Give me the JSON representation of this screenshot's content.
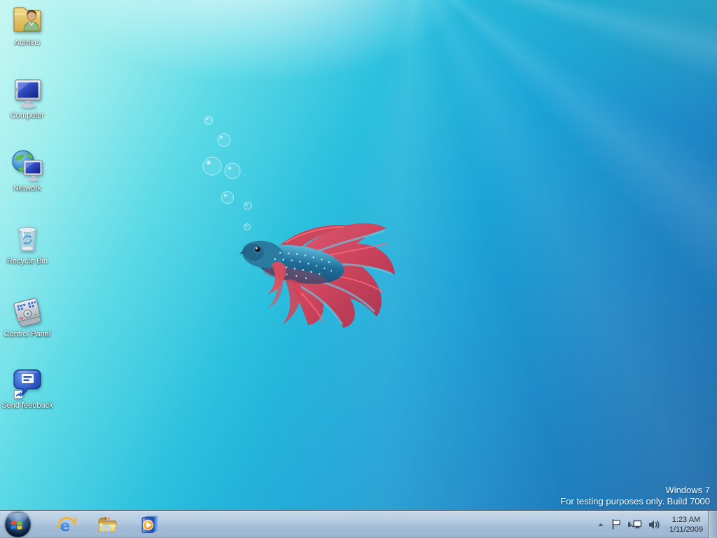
{
  "desktop": {
    "icons": [
      {
        "name": "user-folder-icon",
        "label": "Admins"
      },
      {
        "name": "computer-icon",
        "label": "Computer"
      },
      {
        "name": "network-icon",
        "label": "Network"
      },
      {
        "name": "recycle-bin-icon",
        "label": "Recycle Bin"
      },
      {
        "name": "control-panel-icon",
        "label": "Control Panel"
      },
      {
        "name": "send-feedback-icon",
        "label": "Send feedback"
      }
    ],
    "wallpaper": {
      "description_icons": [
        "betta-fish-art",
        "bubbles-art"
      ],
      "colors": {
        "top_left": "#c9f7f3",
        "mid": "#1ba2d6",
        "bottom_right": "#1c67a4"
      }
    },
    "watermark": {
      "line1": "Windows 7",
      "line2": "For testing purposes only. Build 7000",
      "color": "#ffffff"
    }
  },
  "taskbar": {
    "colors": {
      "bar_tint": "#aec6de",
      "icon_stroke": "#3d4a5a",
      "clock_text": "#1e2a38"
    },
    "start_button": {
      "icon": "windows-start-orb"
    },
    "pinned_icons": [
      {
        "icon": "internet-explorer-icon"
      },
      {
        "icon": "windows-explorer-icon"
      },
      {
        "icon": "windows-media-player-icon"
      }
    ],
    "tray": {
      "icons": [
        {
          "icon": "show-hidden-icons-chevron"
        },
        {
          "icon": "action-center-flag-icon"
        },
        {
          "icon": "network-status-icon"
        },
        {
          "icon": "volume-icon"
        }
      ],
      "clock": {
        "time": "1:23 AM",
        "date": "1/11/2009"
      }
    },
    "show_desktop": {
      "icon": "show-desktop-strip"
    }
  }
}
